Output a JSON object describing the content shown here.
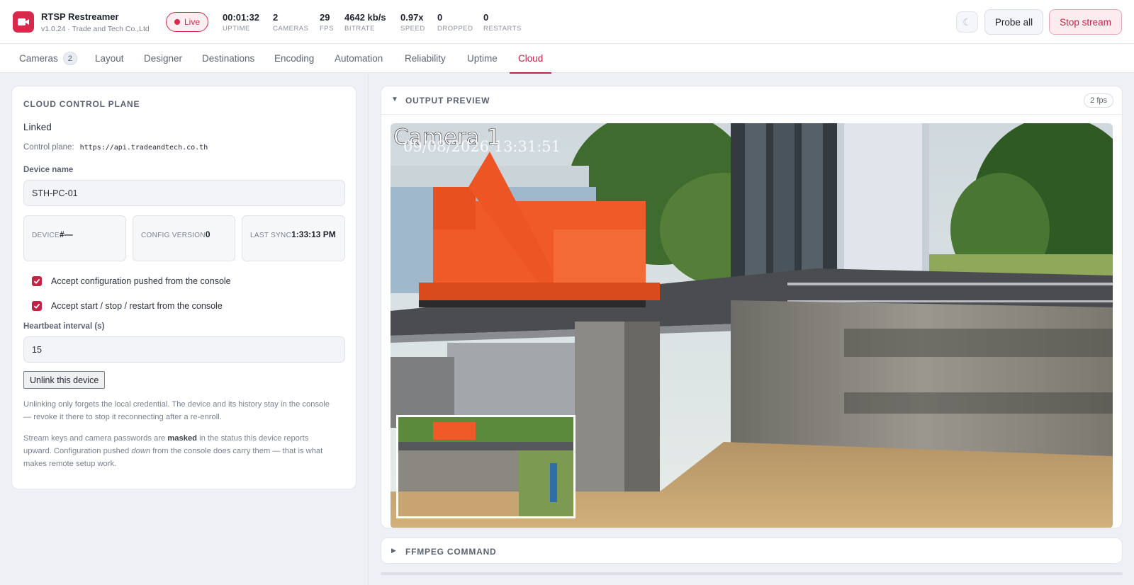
{
  "app": {
    "name": "RTSP Restreamer",
    "subtitle": "v1.0.24 · Trade and Tech Co.,Ltd",
    "live_label": "Live"
  },
  "stats": [
    {
      "value": "00:01:32",
      "label": "UPTIME"
    },
    {
      "value": "2",
      "label": "CAMERAS"
    },
    {
      "value": "29",
      "label": "FPS"
    },
    {
      "value": "4642 kb/s",
      "label": "BITRATE"
    },
    {
      "value": "0.97x",
      "label": "SPEED"
    },
    {
      "value": "0",
      "label": "DROPPED"
    },
    {
      "value": "0",
      "label": "RESTARTS"
    }
  ],
  "header_actions": {
    "theme_icon": "moon-icon",
    "theme_glyph": "☾",
    "probe_label": "Probe all",
    "stop_label": "Stop stream"
  },
  "tabs": [
    {
      "label": "Cameras",
      "badge": "2"
    },
    {
      "label": "Layout"
    },
    {
      "label": "Designer"
    },
    {
      "label": "Destinations"
    },
    {
      "label": "Encoding"
    },
    {
      "label": "Automation"
    },
    {
      "label": "Reliability"
    },
    {
      "label": "Uptime"
    },
    {
      "label": "Cloud",
      "active": true
    }
  ],
  "cloud": {
    "title": "CLOUD CONTROL PLANE",
    "status": "Linked",
    "control_plane_label": "Control plane:",
    "control_plane_url": "https://api.tradeandtech.co.th",
    "device_name_label": "Device name",
    "device_name_value": "STH-PC-01",
    "device_label": "DEVICE",
    "device_value": "#—",
    "config_version_label": "CONFIG VERSION",
    "config_version_value": "0",
    "last_sync_label": "LAST SYNC",
    "last_sync_value": "1:33:13 PM",
    "accept_config_label": "Accept configuration pushed from the console",
    "accept_config_checked": true,
    "accept_control_label": "Accept start / stop / restart from the console",
    "accept_control_checked": true,
    "heartbeat_label": "Heartbeat interval (s)",
    "heartbeat_value": "15",
    "unlink_label": "Unlink this device",
    "note1": "Unlinking only forgets the local credential. The device and its history stay in the console — revoke it there to stop it reconnecting after a re-enroll.",
    "note2_a": "Stream keys and camera passwords are ",
    "note2_b": "masked",
    "note2_c": " in the status this device reports upward. Configuration pushed ",
    "note2_d": "down",
    "note2_e": " from the console does carry them — that is what makes remote setup work."
  },
  "preview": {
    "title": "OUTPUT PREVIEW",
    "fps": "2 fps",
    "camera_label": "Camera 1",
    "timestamp": "09/08/2026 13:31:51"
  },
  "ffmpeg": {
    "title": "FFMPEG COMMAND"
  },
  "colors": {
    "accent": "#c32446",
    "live": "#d8294d",
    "crane_orange": "#f05a28",
    "water": "#b08d5f"
  }
}
